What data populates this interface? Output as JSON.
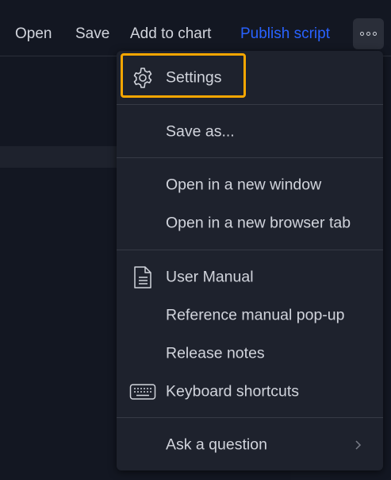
{
  "toolbar": {
    "open_label": "Open",
    "save_label": "Save",
    "add_to_chart_label": "Add to chart",
    "publish_label": "Publish script",
    "more_icon": "more-horizontal-icon"
  },
  "menu": {
    "settings": {
      "label": "Settings",
      "icon": "gear-icon"
    },
    "save_as": {
      "label": "Save as..."
    },
    "open_new_window": {
      "label": "Open in a new window"
    },
    "open_new_tab": {
      "label": "Open in a new browser tab"
    },
    "user_manual": {
      "label": "User Manual",
      "icon": "document-icon"
    },
    "reference_manual": {
      "label": "Reference manual pop-up"
    },
    "release_notes": {
      "label": "Release notes"
    },
    "keyboard_shortcuts": {
      "label": "Keyboard shortcuts",
      "icon": "keyboard-icon"
    },
    "ask_question": {
      "label": "Ask a question",
      "icon": "chevron-right-icon"
    }
  },
  "colors": {
    "background": "#131722",
    "menu_background": "#1e222d",
    "text": "#d1d4dc",
    "accent_blue": "#2962ff",
    "focus_orange": "#f7a600"
  }
}
